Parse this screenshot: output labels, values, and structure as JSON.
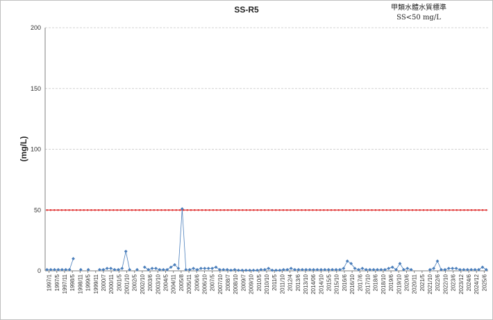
{
  "chart_data": {
    "type": "line",
    "title": "SS-R5",
    "annotation": [
      "甲類水體水質標準",
      "SS<50 mg/L"
    ],
    "ylabel": "(mg/L)",
    "xlabel": "",
    "ylim": [
      0,
      200
    ],
    "yticks": [
      0,
      50,
      100,
      150,
      200
    ],
    "grid": true,
    "legend": "none",
    "colors": {
      "series": "#4a7ebb",
      "standard": "#e03030",
      "grid": "#d0d0d0"
    },
    "categories": [
      "1997/1",
      "1997/5",
      "1997/11",
      "1998/5",
      "1998/11",
      "1999/5",
      "1999/11",
      "2000/7",
      "2000/11",
      "2001/5",
      "2001/10",
      "2002/5",
      "2002/10",
      "2003/6",
      "2003/10",
      "2004/5",
      "2004/11",
      "2005/8",
      "2005/11",
      "2006/6",
      "2006/10",
      "2007/5",
      "2007/10",
      "2008/7",
      "2008/10",
      "2009/7",
      "2009/10",
      "2010/5",
      "2010/10",
      "2011/5",
      "2011/10",
      "2012/4",
      "2013/6",
      "2013/10",
      "2014/06",
      "2014/10",
      "2015/5",
      "2015/10",
      "2016/6",
      "2016/10",
      "2017/6",
      "2017/10",
      "2018/6",
      "2018/10",
      "2019/6",
      "2019/10",
      "2020/6",
      "2020/11",
      "2021/5",
      "2021/10",
      "2022/6",
      "2022/10",
      "2023/6",
      "2023/12",
      "2024/6",
      "2024/12",
      "2025/6"
    ],
    "series": [
      {
        "name": "",
        "values": [
          1,
          1,
          1,
          1,
          1,
          1,
          1,
          10,
          null,
          1,
          null,
          1,
          null,
          null,
          1,
          1,
          2,
          2,
          1,
          1,
          2,
          16,
          1,
          null,
          1,
          null,
          3,
          1,
          2,
          2,
          1,
          1,
          1,
          3,
          5,
          2,
          51,
          1,
          1,
          2,
          1,
          2,
          2,
          2,
          2,
          3,
          1,
          1,
          1,
          0.5,
          1,
          0.5,
          0.5,
          0.5,
          0.5,
          0.5,
          0.5,
          1,
          1,
          2,
          0.5,
          0.5,
          0.5,
          1,
          1,
          2,
          1,
          1,
          1,
          1,
          1,
          1,
          1,
          1,
          1,
          1,
          1,
          1,
          1,
          2,
          8,
          6,
          2,
          1,
          2,
          1,
          1,
          1,
          1,
          1,
          1,
          2,
          3,
          1,
          6,
          1,
          2,
          1,
          null,
          null,
          null,
          null,
          1,
          2,
          8,
          1,
          1,
          2,
          2,
          2,
          1,
          1,
          1,
          1,
          1,
          1,
          3,
          1
        ]
      },
      {
        "name": "",
        "values": [
          50,
          50,
          50,
          50,
          50,
          50,
          50,
          50,
          50,
          50,
          50,
          50,
          50,
          50,
          50,
          50,
          50,
          50,
          50,
          50,
          50,
          50,
          50,
          50,
          50,
          50,
          50,
          50,
          50,
          50,
          50,
          50,
          50,
          50,
          50,
          50,
          50,
          50,
          50,
          50,
          50,
          50,
          50,
          50,
          50,
          50,
          50,
          50,
          50,
          50,
          50,
          50,
          50,
          50,
          50,
          50,
          50,
          50,
          50,
          50,
          50,
          50,
          50,
          50,
          50,
          50,
          50,
          50,
          50,
          50,
          50,
          50,
          50,
          50,
          50,
          50,
          50,
          50,
          50,
          50,
          50,
          50,
          50,
          50,
          50,
          50,
          50,
          50,
          50,
          50,
          50,
          50,
          50,
          50,
          50,
          50,
          50,
          50,
          50,
          50,
          50,
          50,
          50,
          50,
          50,
          50,
          50,
          50,
          50,
          50,
          50,
          50,
          50,
          50,
          50,
          50,
          50,
          50,
          50,
          50
        ]
      }
    ]
  }
}
